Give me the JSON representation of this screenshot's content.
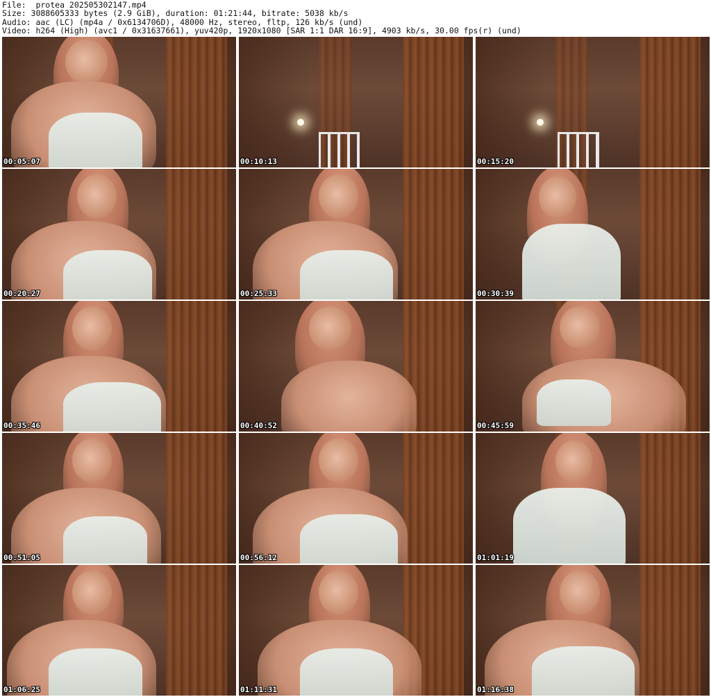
{
  "header": {
    "file_line": "File: _protea_202505302147.mp4",
    "size_line": "Size: 3088605333 bytes (2.9 GiB), duration: 01:21:44, bitrate: 5038 kb/s",
    "audio_line": "Audio: aac (LC) (mp4a / 0x6134706D), 48000 Hz, stereo, fltp, 126 kb/s (und)",
    "video_line": "Video: h264 (High) (avc1 / 0x31637661), yuv420p, 1920x1080 [SAR 1:1 DAR 16:9], 4903 kb/s, 30.00 fps(r) (und)"
  },
  "thumbnails": [
    {
      "timestamp": "00:05:07"
    },
    {
      "timestamp": "00:10:13"
    },
    {
      "timestamp": "00:15:20"
    },
    {
      "timestamp": "00:20:27"
    },
    {
      "timestamp": "00:25:33"
    },
    {
      "timestamp": "00:30:39"
    },
    {
      "timestamp": "00:35:46"
    },
    {
      "timestamp": "00:40:52"
    },
    {
      "timestamp": "00:45:59"
    },
    {
      "timestamp": "00:51:05"
    },
    {
      "timestamp": "00:56:12"
    },
    {
      "timestamp": "01:01:19"
    },
    {
      "timestamp": "01:06:25"
    },
    {
      "timestamp": "01:11:31"
    },
    {
      "timestamp": "01:16:38"
    }
  ]
}
